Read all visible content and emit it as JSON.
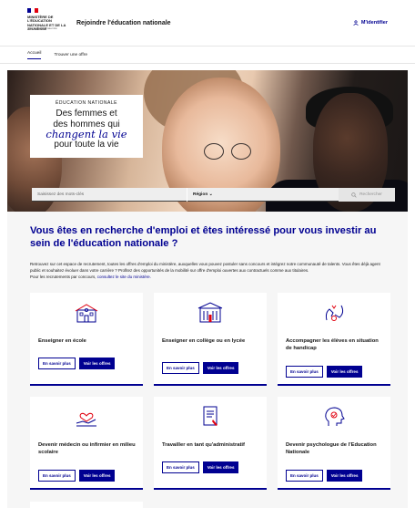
{
  "header": {
    "logo_text": "MINISTÈRE DE L'ÉDUCATION NATIONALE ET DE LA JEUNESSE",
    "logo_motto": "Liberté Égalité Fraternité",
    "site_title": "Rejoindre l'éducation nationale",
    "login_label": "M'identifier"
  },
  "nav": {
    "items": [
      "Accueil",
      "Trouver une offre"
    ]
  },
  "hero": {
    "eyebrow": "ÉDUCATION NATIONALE",
    "line1": "Des femmes et",
    "line2": "des hommes qui",
    "script": "changent la vie",
    "line3": "pour toute la vie"
  },
  "search": {
    "keywords_placeholder": "Saisissez des mots-clés",
    "region_label": "Région ⌄",
    "button_label": "Rechercher"
  },
  "intro": {
    "heading": "Vous êtes en recherche d'emploi et êtes intéressé pour vous investir au sein de l'éducation nationale ?",
    "paragraph": "Retrouvez sur cet espace de recrutement, toutes les offres d'emploi du ministère, auxquelles vous pouvez postuler sans concours et intégrez notre communauté de talents. Vous êtes déjà agent public et souhaitez évoluer dans votre carrière ? Profitez des opportunités de la mobilité sur offre d'emploi ouvertes aux contractuels comme aux titulaires.",
    "paragraph2_prefix": "Pour les recrutements par concours, ",
    "paragraph2_link": "consultez le site du ministère."
  },
  "cards": [
    {
      "title": "Enseigner en école",
      "more": "En savoir plus",
      "offers": "Voir les offres",
      "icon": "school-icon"
    },
    {
      "title": "Enseigner en collège ou en lycée",
      "more": "En savoir plus",
      "offers": "Voir les offres",
      "icon": "building-icon"
    },
    {
      "title": "Accompagner les élèves en situation de handicap",
      "more": "En savoir plus",
      "offers": "Voir les offres",
      "icon": "helping-hand-icon"
    },
    {
      "title": "Devenir médecin ou infirmier en milieu scolaire",
      "more": "En savoir plus",
      "offers": "Voir les offres",
      "icon": "heart-hand-icon"
    },
    {
      "title": "Travailler en tant qu'administratif",
      "more": "En savoir plus",
      "offers": "Voir les offres",
      "icon": "document-icon"
    },
    {
      "title": "Devenir psychologue de l'Education Nationale",
      "more": "En savoir plus",
      "offers": "Voir les offres",
      "icon": "head-icon"
    }
  ],
  "colors": {
    "primary": "#000091",
    "accent_red": "#e1000f",
    "background_light": "#f6f6f6"
  }
}
